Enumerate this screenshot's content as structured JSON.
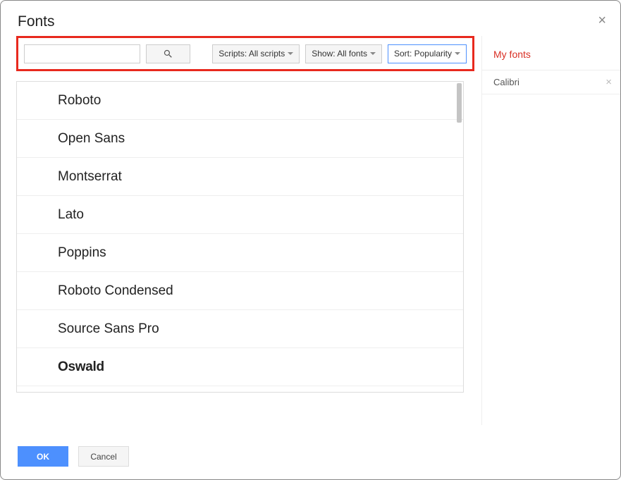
{
  "dialog": {
    "title": "Fonts",
    "close_symbol": "×"
  },
  "toolbar": {
    "search_value": "",
    "scripts_label": "Scripts: All scripts",
    "show_label": "Show: All fonts",
    "sort_label": "Sort: Popularity"
  },
  "fonts": [
    "Roboto",
    "Open Sans",
    "Montserrat",
    "Lato",
    "Poppins",
    "Roboto Condensed",
    "Source Sans Pro",
    "Oswald"
  ],
  "sidebar": {
    "header": "My fonts",
    "items": [
      {
        "name": "Calibri"
      }
    ],
    "remove_symbol": "×"
  },
  "buttons": {
    "ok": "OK",
    "cancel": "Cancel"
  }
}
